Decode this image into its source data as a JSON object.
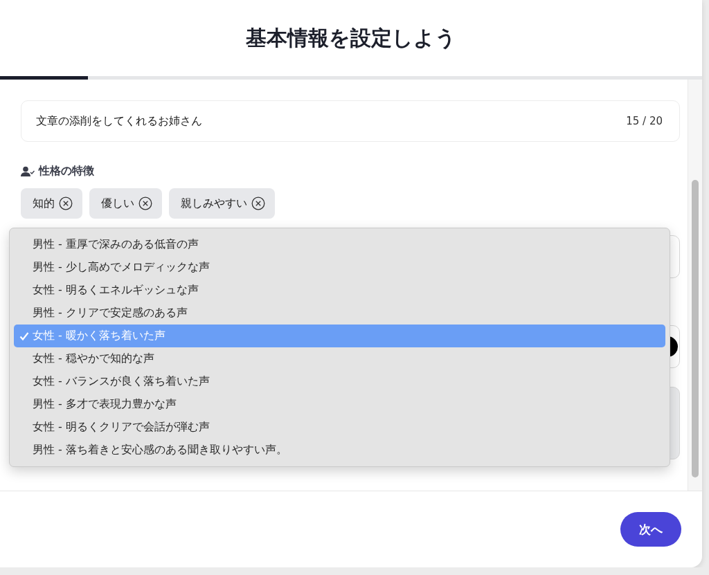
{
  "title": "基本情報を設定しよう",
  "progress": {
    "level": 0.125
  },
  "name_field": {
    "value": "文章の添削をしてくれるお姉さん",
    "counter": "15 / 20"
  },
  "traits": {
    "label": "性格の特徴",
    "tags": [
      {
        "label": "知的"
      },
      {
        "label": "優しい"
      },
      {
        "label": "親しみやすい"
      }
    ]
  },
  "voice_dropdown": {
    "options": [
      {
        "label": "男性 - 重厚で深みのある低音の声",
        "selected": false
      },
      {
        "label": "男性 - 少し高めでメロディックな声",
        "selected": false
      },
      {
        "label": "女性 - 明るくエネルギッシュな声",
        "selected": false
      },
      {
        "label": "男性 - クリアで安定感のある声",
        "selected": false
      },
      {
        "label": "女性 - 暖かく落ち着いた声",
        "selected": true
      },
      {
        "label": "女性 - 穏やかで知的な声",
        "selected": false
      },
      {
        "label": "女性 - バランスが良く落ち着いた声",
        "selected": false
      },
      {
        "label": "男性 - 多才で表現力豊かな声",
        "selected": false
      },
      {
        "label": "女性 - 明るくクリアで会話が弾む声",
        "selected": false
      },
      {
        "label": "男性 - 落ち着きと安心感のある聞き取りやすい声。",
        "selected": false
      }
    ]
  },
  "next_button": "次へ"
}
